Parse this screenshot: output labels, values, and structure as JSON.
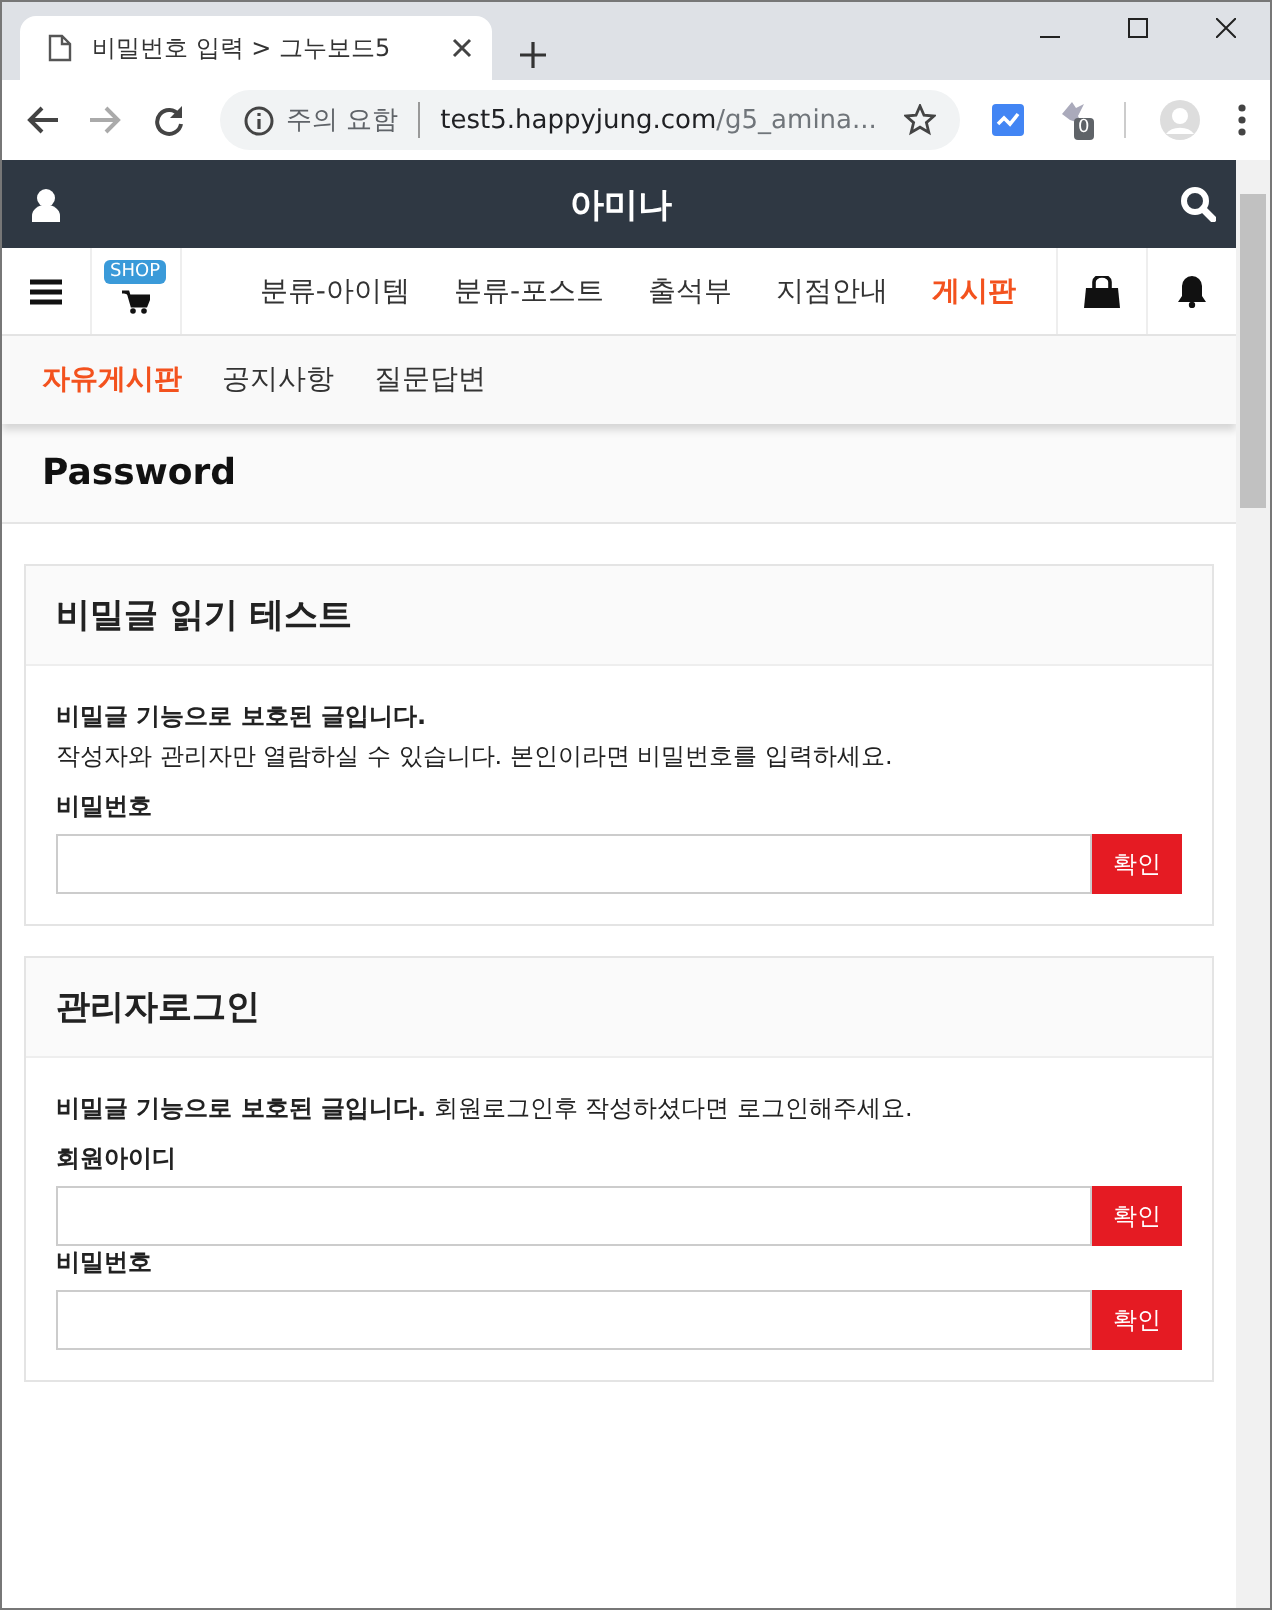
{
  "browser": {
    "tab_title": "비밀번호 입력 > 그누보드5",
    "security": "주의 요함",
    "url_host": "test5.happyjung.com",
    "url_path": "/g5_amina...",
    "extension_badge": "0"
  },
  "header": {
    "title": "아미나"
  },
  "nav": {
    "shop_badge": "SHOP",
    "items": [
      {
        "label": "분류-아이템",
        "selected": false
      },
      {
        "label": "분류-포스트",
        "selected": false
      },
      {
        "label": "출석부",
        "selected": false
      },
      {
        "label": "지점안내",
        "selected": false
      },
      {
        "label": "게시판",
        "selected": true
      }
    ]
  },
  "subnav": [
    {
      "label": "자유게시판",
      "selected": true
    },
    {
      "label": "공지사항",
      "selected": false
    },
    {
      "label": "질문답변",
      "selected": false
    }
  ],
  "page_title": "Password",
  "cards": [
    {
      "title": "비밀글 읽기 테스트",
      "notices": [
        {
          "text": "비밀글 기능으로 보호된 글입니다.",
          "bold": true
        },
        {
          "text": "작성자와 관리자만 열람하실 수 있습니다. 본인이라면 비밀번호를 입력하세요.",
          "bold": false
        }
      ],
      "fields": [
        {
          "label": "비밀번호",
          "button": "확인"
        }
      ]
    },
    {
      "title": "관리자로그인",
      "notices": [
        {
          "text": "**비밀글 기능으로 보호된 글입니다.** 회원로그인후 작성하셨다면 로그인해주세요.",
          "bold": false
        }
      ],
      "fields": [
        {
          "label": "회원아이디",
          "button": "확인"
        },
        {
          "label": "비밀번호",
          "button": "확인"
        }
      ]
    }
  ]
}
